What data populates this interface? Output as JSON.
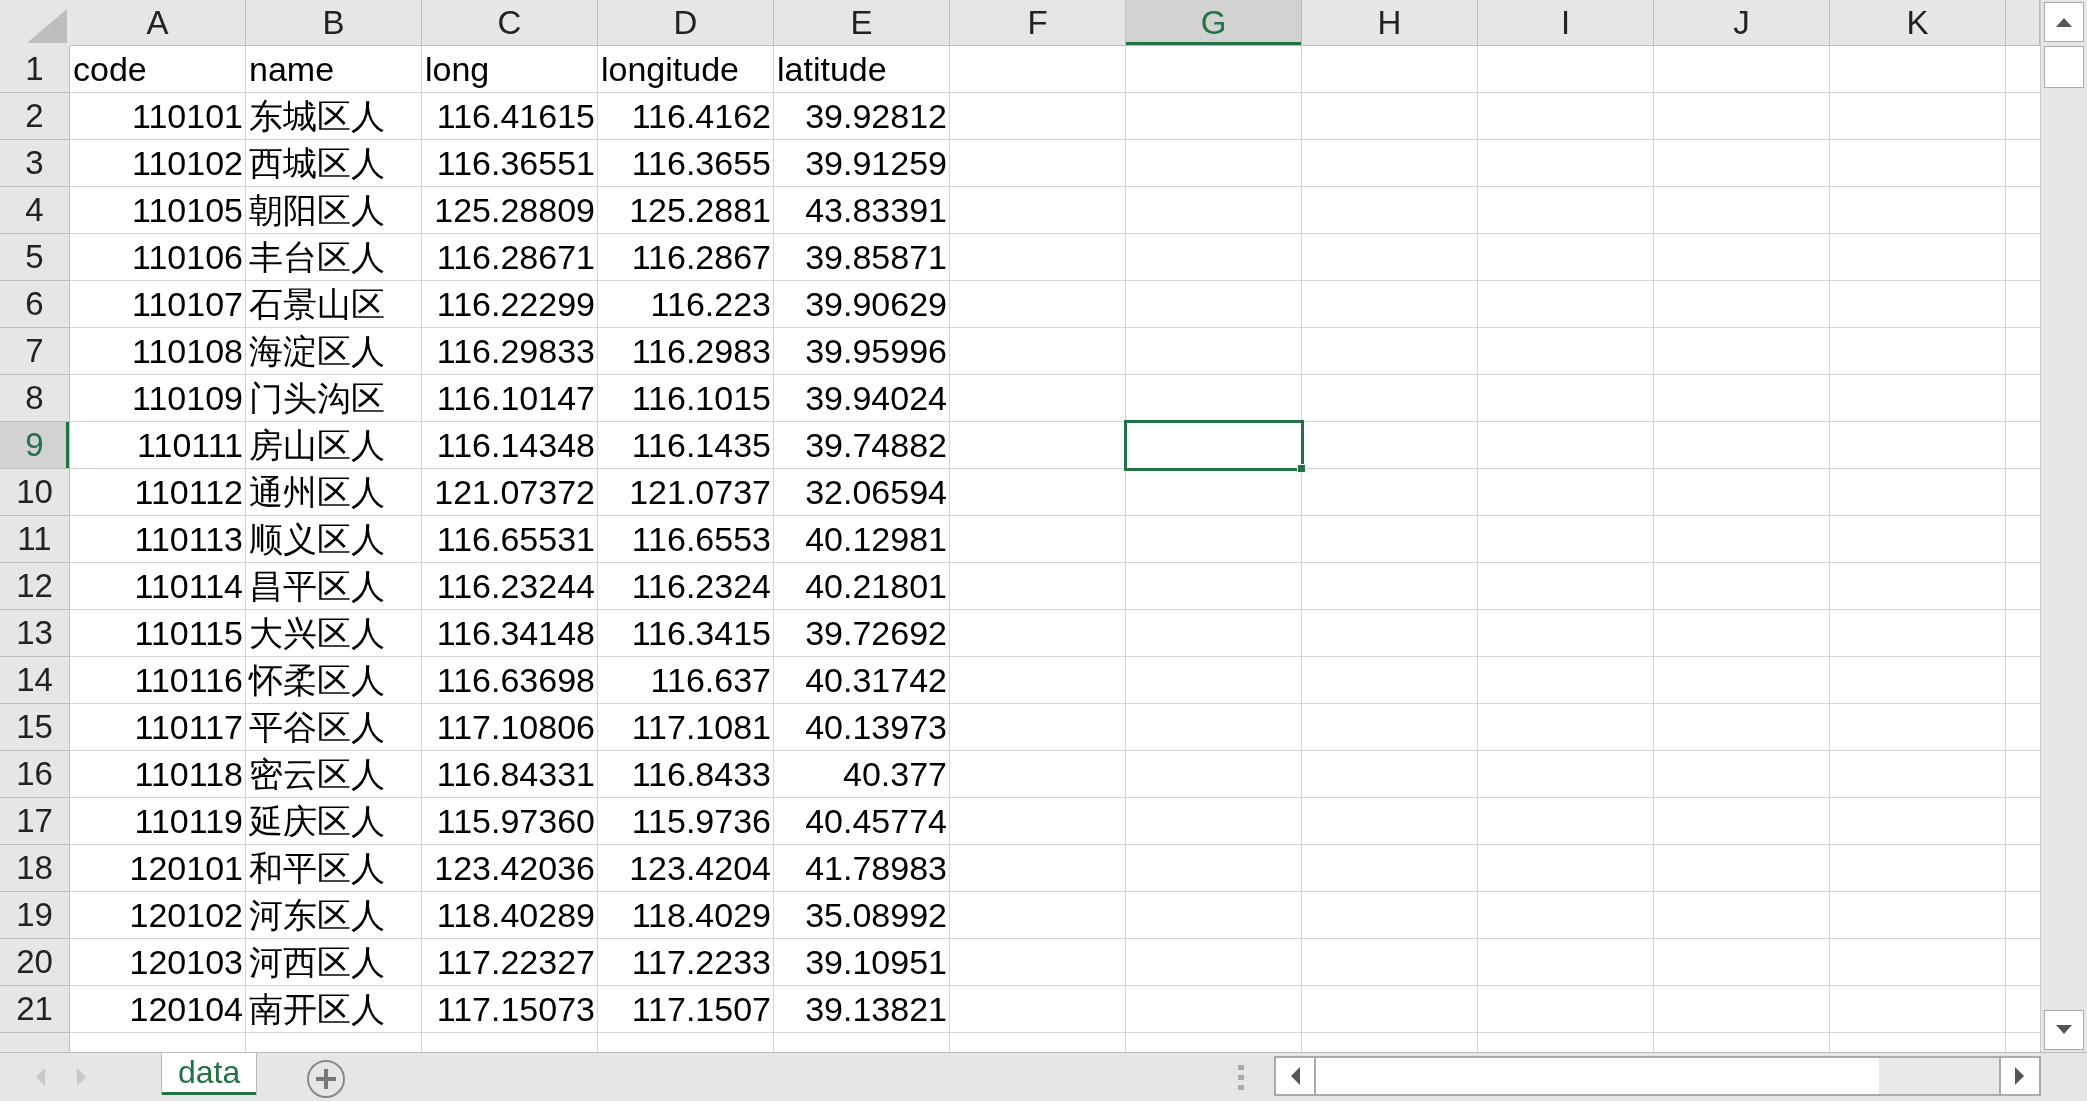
{
  "columns": [
    {
      "label": "A",
      "selected": false,
      "kind": "number"
    },
    {
      "label": "B",
      "selected": false,
      "kind": "text"
    },
    {
      "label": "C",
      "selected": false,
      "kind": "number"
    },
    {
      "label": "D",
      "selected": false,
      "kind": "number"
    },
    {
      "label": "E",
      "selected": false,
      "kind": "number"
    },
    {
      "label": "F",
      "selected": false
    },
    {
      "label": "G",
      "selected": true
    },
    {
      "label": "H",
      "selected": false
    },
    {
      "label": "I",
      "selected": false
    },
    {
      "label": "J",
      "selected": false
    },
    {
      "label": "K",
      "selected": false
    }
  ],
  "rows": [
    {
      "header": "1",
      "kind": "header",
      "selected": false,
      "cells": [
        "code",
        "name",
        "long",
        "longitude",
        "latitude"
      ]
    },
    {
      "header": "2",
      "kind": "data",
      "selected": false,
      "cells": [
        "110101",
        "东城区人",
        "116.41615",
        "116.4162",
        "39.92812"
      ]
    },
    {
      "header": "3",
      "kind": "data",
      "selected": false,
      "cells": [
        "110102",
        "西城区人",
        "116.36551",
        "116.3655",
        "39.91259"
      ]
    },
    {
      "header": "4",
      "kind": "data",
      "selected": false,
      "cells": [
        "110105",
        "朝阳区人",
        "125.28809",
        "125.2881",
        "43.83391"
      ]
    },
    {
      "header": "5",
      "kind": "data",
      "selected": false,
      "cells": [
        "110106",
        "丰台区人",
        "116.28671",
        "116.2867",
        "39.85871"
      ]
    },
    {
      "header": "6",
      "kind": "data",
      "selected": false,
      "cells": [
        "110107",
        "石景山区",
        "116.22299",
        "116.223",
        "39.90629"
      ]
    },
    {
      "header": "7",
      "kind": "data",
      "selected": false,
      "cells": [
        "110108",
        "海淀区人",
        "116.29833",
        "116.2983",
        "39.95996"
      ]
    },
    {
      "header": "8",
      "kind": "data",
      "selected": false,
      "cells": [
        "110109",
        "门头沟区",
        "116.10147",
        "116.1015",
        "39.94024"
      ]
    },
    {
      "header": "9",
      "kind": "data",
      "selected": true,
      "cells": [
        "110111",
        "房山区人",
        "116.14348",
        "116.1435",
        "39.74882"
      ]
    },
    {
      "header": "10",
      "kind": "data",
      "selected": false,
      "cells": [
        "110112",
        "通州区人",
        "121.07372",
        "121.0737",
        "32.06594"
      ]
    },
    {
      "header": "11",
      "kind": "data",
      "selected": false,
      "cells": [
        "110113",
        "顺义区人",
        "116.65531",
        "116.6553",
        "40.12981"
      ]
    },
    {
      "header": "12",
      "kind": "data",
      "selected": false,
      "cells": [
        "110114",
        "昌平区人",
        "116.23244",
        "116.2324",
        "40.21801"
      ]
    },
    {
      "header": "13",
      "kind": "data",
      "selected": false,
      "cells": [
        "110115",
        "大兴区人",
        "116.34148",
        "116.3415",
        "39.72692"
      ]
    },
    {
      "header": "14",
      "kind": "data",
      "selected": false,
      "cells": [
        "110116",
        "怀柔区人",
        "116.63698",
        "116.637",
        "40.31742"
      ]
    },
    {
      "header": "15",
      "kind": "data",
      "selected": false,
      "cells": [
        "110117",
        "平谷区人",
        "117.10806",
        "117.1081",
        "40.13973"
      ]
    },
    {
      "header": "16",
      "kind": "data",
      "selected": false,
      "cells": [
        "110118",
        "密云区人",
        "116.84331",
        "116.8433",
        "40.377"
      ]
    },
    {
      "header": "17",
      "kind": "data",
      "selected": false,
      "cells": [
        "110119",
        "延庆区人",
        "115.97360",
        "115.9736",
        "40.45774"
      ]
    },
    {
      "header": "18",
      "kind": "data",
      "selected": false,
      "cells": [
        "120101",
        "和平区人",
        "123.42036",
        "123.4204",
        "41.78983"
      ]
    },
    {
      "header": "19",
      "kind": "data",
      "selected": false,
      "cells": [
        "120102",
        "河东区人",
        "118.40289",
        "118.4029",
        "35.08992"
      ]
    },
    {
      "header": "20",
      "kind": "data",
      "selected": false,
      "cells": [
        "120103",
        "河西区人",
        "117.22327",
        "117.2233",
        "39.10951"
      ]
    },
    {
      "header": "21",
      "kind": "data",
      "selected": false,
      "cells": [
        "120104",
        "南开区人",
        "117.15073",
        "117.1507",
        "39.13821"
      ]
    }
  ],
  "sheet_tabs": [
    {
      "label": "data",
      "selected": true
    }
  ]
}
